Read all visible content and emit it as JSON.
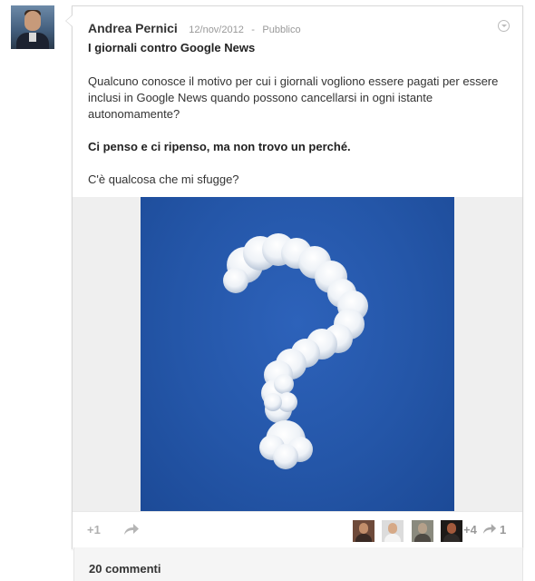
{
  "post": {
    "author": "Andrea Pernici",
    "date": "12/nov/2012",
    "separator": "-",
    "visibility": "Pubblico",
    "title": "I giornali contro Google News",
    "paragraph1": "Qualcuno conosce il motivo per cui i giornali vogliono essere pagati per essere inclusi in Google News quando possono cancellarsi in ogni istante autonomamente?",
    "paragraph2": "Ci penso e ci ripenso, ma non trovo un perché.",
    "paragraph3": "C'è qualcosa che mi sfugge?"
  },
  "image": {
    "icon": "question-mark-cloud-icon",
    "background_color": "#2456a8"
  },
  "actions": {
    "plus_one_label": "+1",
    "plus_count": "+4",
    "reshare_count": "1",
    "share_icon": "share-arrow-icon"
  },
  "comments": {
    "label": "20 commenti"
  },
  "colors": {
    "author_text": "#333333",
    "meta_text": "#999999",
    "border": "#d8d8d8"
  }
}
